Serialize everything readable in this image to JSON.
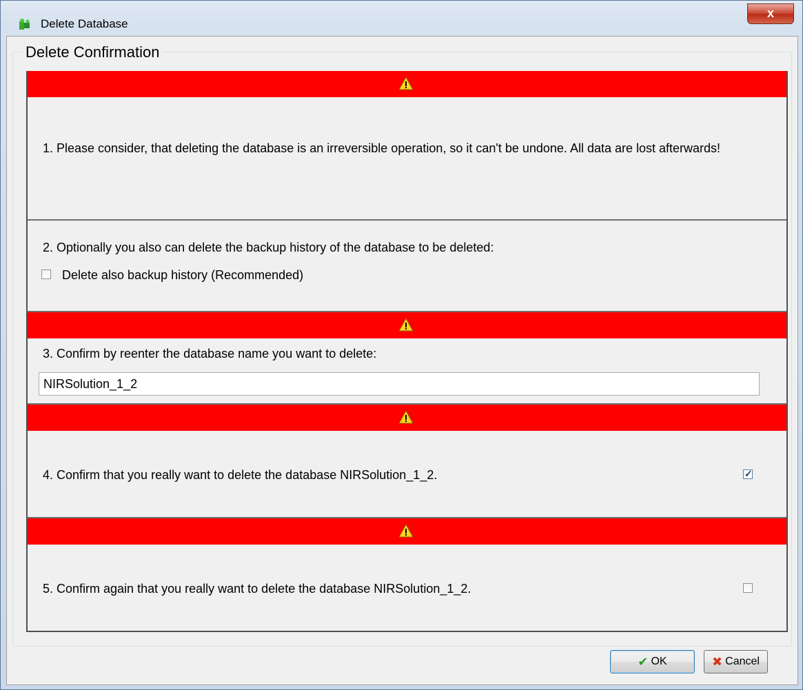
{
  "window": {
    "title": "Delete Database",
    "close_label": "x"
  },
  "group": {
    "title": "Delete Confirmation"
  },
  "steps": {
    "step1": "1. Please consider, that deleting the database is an irreversible operation, so it can't be undone. All data are lost afterwards!",
    "step2": "2. Optionally you also can delete the backup history of the database to be deleted:",
    "step2_checkbox": "Delete also backup history (Recommended)",
    "step2_checked": false,
    "step3": "3. Confirm by reenter the database name you want to delete:",
    "step3_value": "NIRSolution_1_2",
    "step4": "4. Confirm that you really want to delete the database NIRSolution_1_2.",
    "step4_checked": true,
    "step5": "5. Confirm again that you really want to delete the database NIRSolution_1_2.",
    "step5_checked": false
  },
  "buttons": {
    "ok": "OK",
    "cancel": "Cancel"
  },
  "colors": {
    "warning_bar": "#ff0000"
  },
  "icons": {
    "warning": "warning-icon",
    "ok": "check-icon",
    "cancel": "cross-icon",
    "app": "puzzle-icon"
  }
}
